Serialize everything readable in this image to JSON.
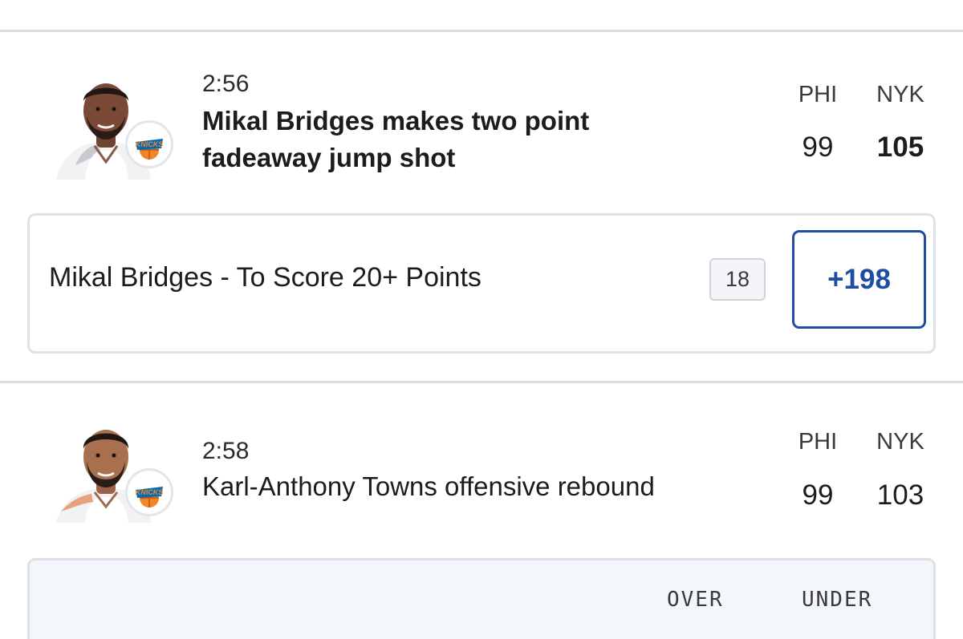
{
  "plays": [
    {
      "time": "2:56",
      "description": "Mikal Bridges makes two point fadeaway jump shot",
      "player_icon": "player-headshot-icon",
      "team_logo_icon": "knicks-logo-icon",
      "away_team": "PHI",
      "home_team": "NYK",
      "away_score": "99",
      "home_score": "105",
      "market": {
        "label": "Mikal Bridges - To Score 20+ Points",
        "count": "18",
        "odds": "+198"
      }
    },
    {
      "time": "2:58",
      "description": "Karl-Anthony Towns offensive rebound",
      "player_icon": "player-headshot-icon",
      "team_logo_icon": "knicks-logo-icon",
      "away_team": "PHI",
      "home_team": "NYK",
      "away_score": "99",
      "home_score": "103",
      "over_under": {
        "over_label": "OVER",
        "under_label": "UNDER"
      }
    }
  ],
  "colors": {
    "odds_blue": "#1e4ea3",
    "knicks_orange": "#f58426",
    "knicks_blue": "#006bb6",
    "divider": "#dcdee3"
  }
}
